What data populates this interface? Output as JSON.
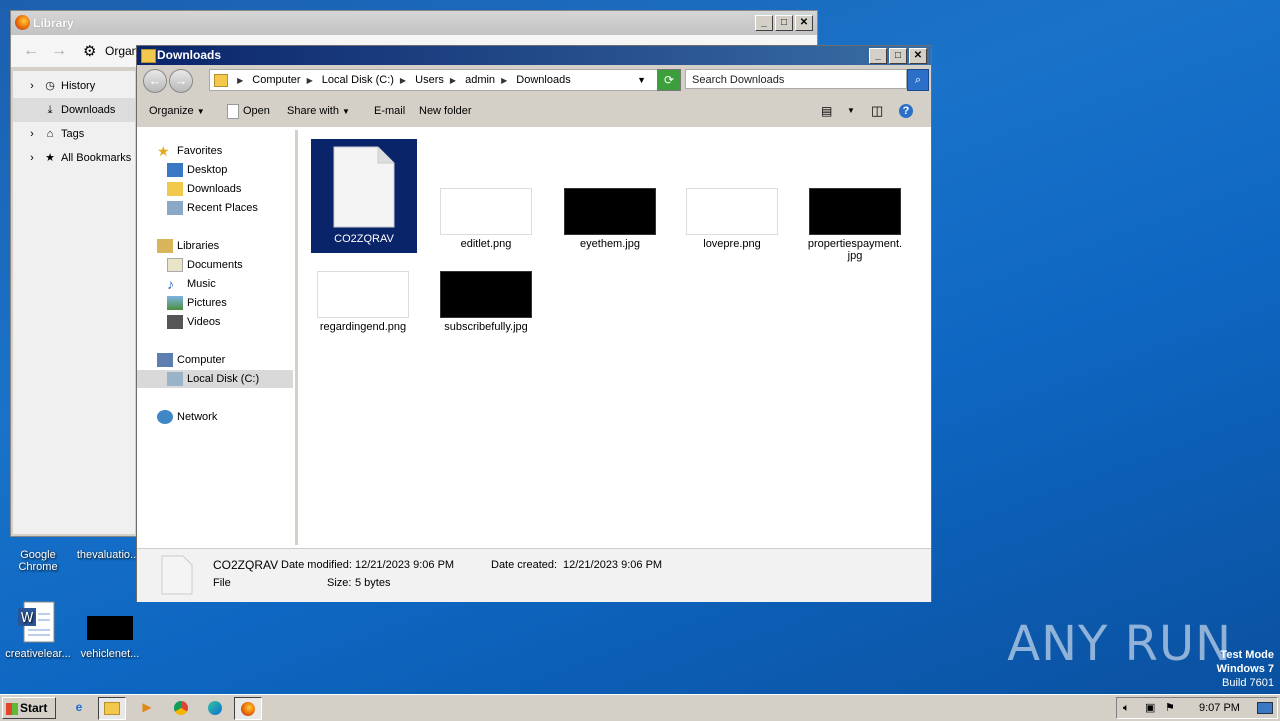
{
  "desktop": {
    "icons": [
      {
        "label": "Google\nChrome"
      },
      {
        "label": "thevaluatio..."
      },
      {
        "label": "creativelear..."
      },
      {
        "label": "vehiclenet..."
      }
    ],
    "watermark": "ANY RUN",
    "test_mode": [
      "Test Mode",
      "Windows 7",
      "Build 7601"
    ]
  },
  "library": {
    "title": "Library",
    "organize": "Organ",
    "items": [
      {
        "label": "History"
      },
      {
        "label": "Downloads"
      },
      {
        "label": "Tags"
      },
      {
        "label": "All Bookmarks"
      }
    ]
  },
  "explorer": {
    "title": "Downloads",
    "breadcrumb": [
      "Computer",
      "Local Disk (C:)",
      "Users",
      "admin",
      "Downloads"
    ],
    "search_placeholder": "Search Downloads",
    "commands": {
      "organize": "Organize",
      "open": "Open",
      "share_with": "Share with",
      "email": "E-mail",
      "new_folder": "New folder"
    },
    "nav": {
      "favorites": "Favorites",
      "desktop": "Desktop",
      "downloads": "Downloads",
      "recent": "Recent Places",
      "libraries": "Libraries",
      "documents": "Documents",
      "music": "Music",
      "pictures": "Pictures",
      "videos": "Videos",
      "computer": "Computer",
      "local_disk": "Local Disk (C:)",
      "network": "Network"
    },
    "files": [
      {
        "name": "CO2ZQRAV"
      },
      {
        "name": "editlet.png"
      },
      {
        "name": "eyethem.jpg"
      },
      {
        "name": "lovepre.png"
      },
      {
        "name": "propertiespayment.\njpg"
      },
      {
        "name": "regardingend.png"
      },
      {
        "name": "subscribefully.jpg"
      }
    ],
    "details": {
      "name": "CO2ZQRAV",
      "modified_label": "Date modified:",
      "modified": "12/21/2023 9:06 PM",
      "created_label": "Date created:",
      "created": "12/21/2023 9:06 PM",
      "type": "File",
      "size_label": "Size:",
      "size": "5 bytes"
    }
  },
  "taskbar": {
    "start": "Start",
    "clock": "9:07 PM"
  }
}
